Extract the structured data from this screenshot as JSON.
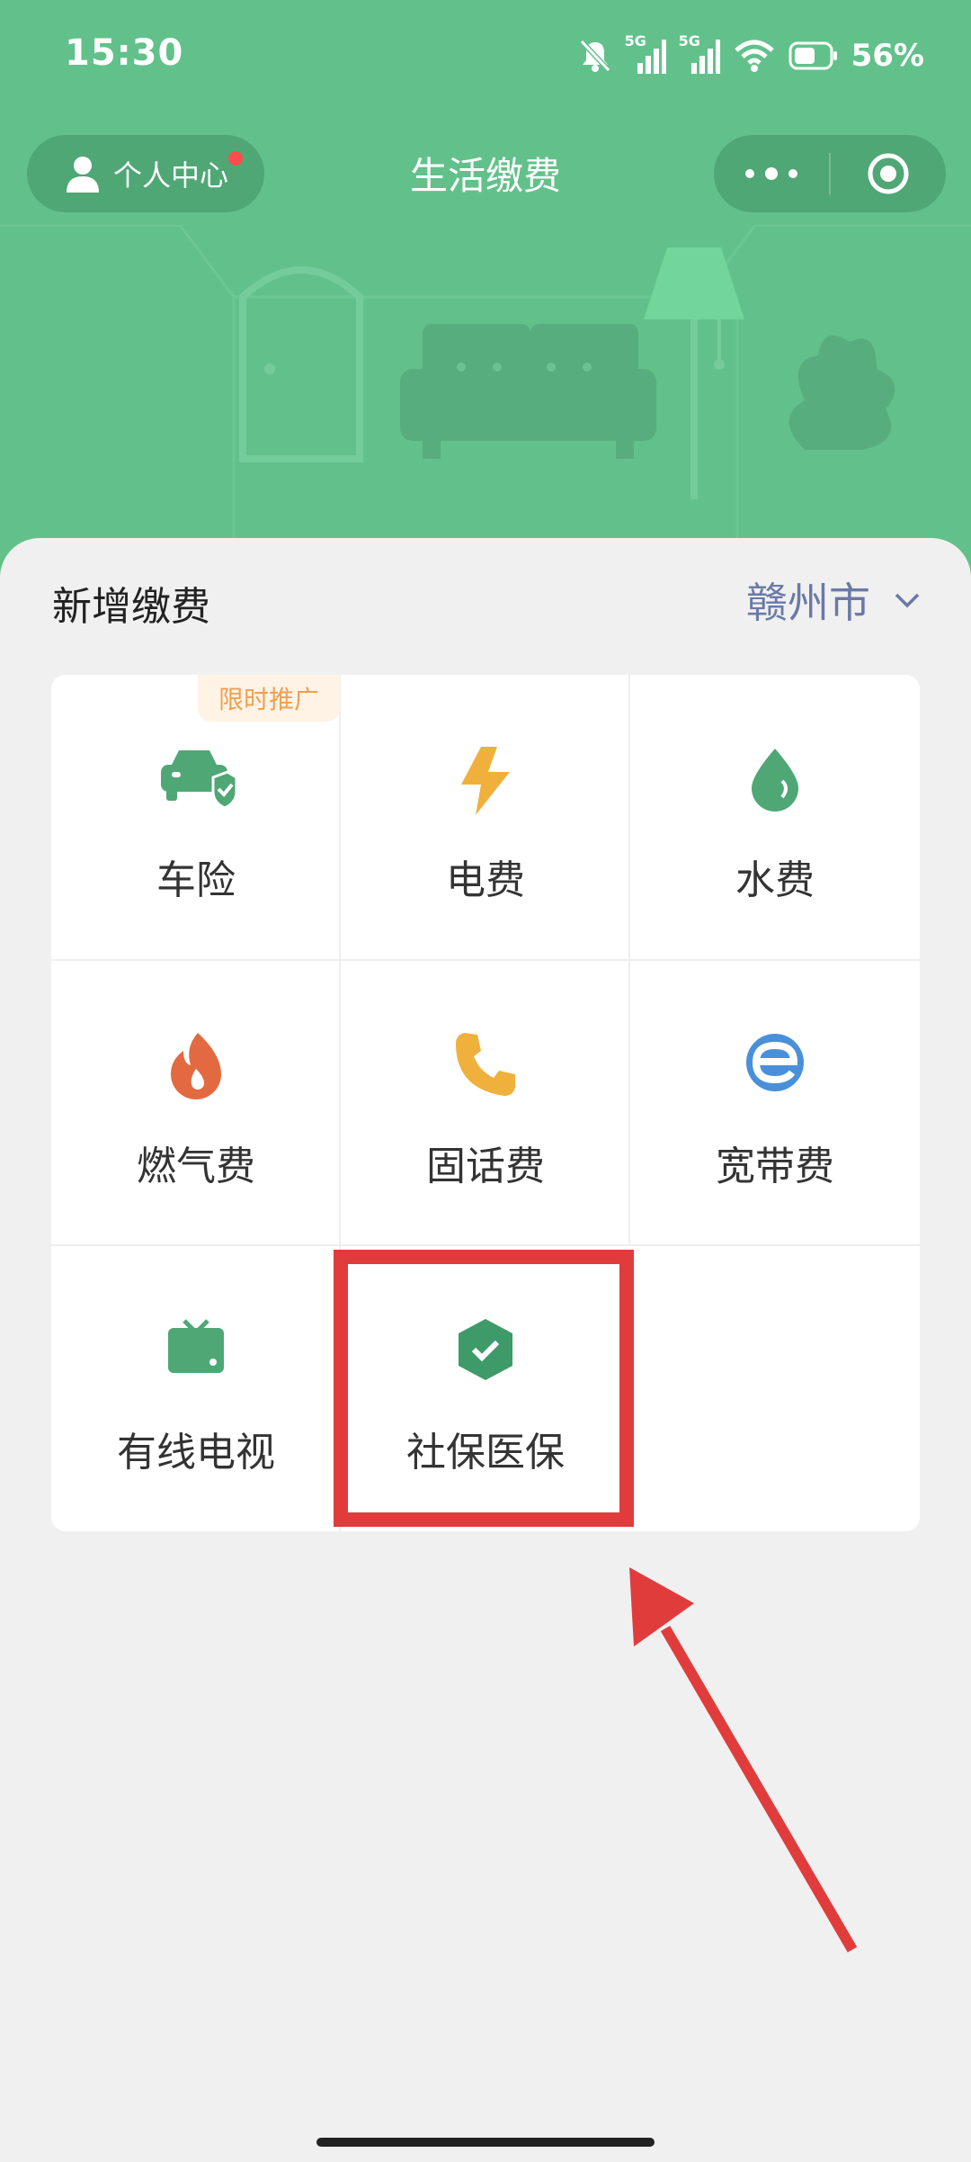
{
  "status_bar": {
    "time": "15:30",
    "network_1": "5G",
    "network_2": "5G",
    "battery": "56%",
    "icons": [
      "mute-bell-icon",
      "signal-icon",
      "signal-icon",
      "wifi-icon",
      "battery-icon"
    ]
  },
  "nav": {
    "profile_label": "个人中心",
    "title": "生活缴费",
    "more_icon": "more-dots-icon",
    "target_icon": "target-circle-icon"
  },
  "section": {
    "title": "新增缴费",
    "city": "赣州市"
  },
  "services": [
    {
      "label": "车险",
      "icon": "car-shield-icon",
      "badge": "限时推广"
    },
    {
      "label": "电费",
      "icon": "lightning-icon"
    },
    {
      "label": "水费",
      "icon": "water-drop-icon"
    },
    {
      "label": "燃气费",
      "icon": "flame-icon"
    },
    {
      "label": "固话费",
      "icon": "phone-icon"
    },
    {
      "label": "宽带费",
      "icon": "broadband-e-icon"
    },
    {
      "label": "有线电视",
      "icon": "tv-icon"
    },
    {
      "label": "社保医保",
      "icon": "shield-check-icon"
    }
  ],
  "colors": {
    "header_green": "#62c18a",
    "icon_green": "#4fa775",
    "annotation_red": "#e03c3c",
    "city_text": "#6a7aa6"
  }
}
